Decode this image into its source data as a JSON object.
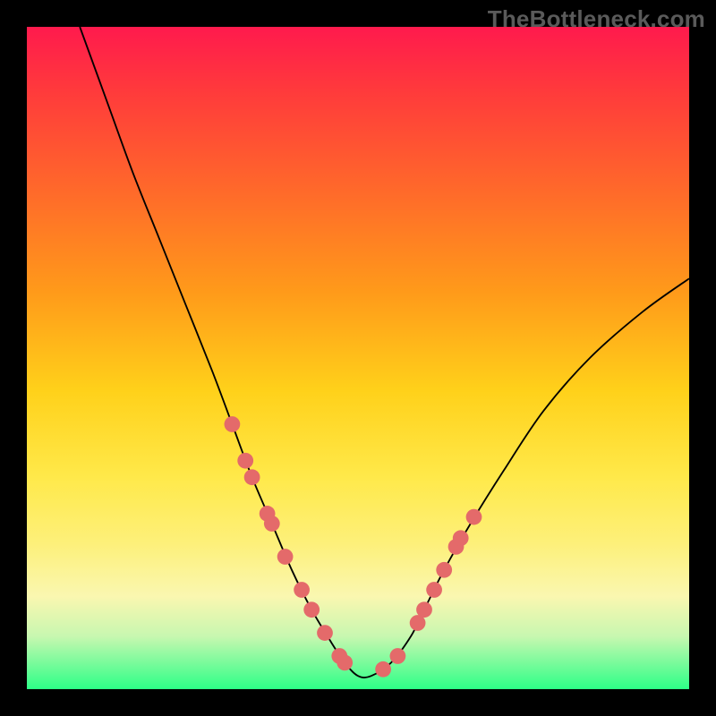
{
  "watermark": "TheBottleneck.com",
  "chart_data": {
    "type": "line",
    "title": "",
    "xlabel": "",
    "ylabel": "",
    "xlim": [
      0,
      100
    ],
    "ylim": [
      0,
      100
    ],
    "grid": false,
    "legend": false,
    "series": [
      {
        "name": "bottleneck-curve",
        "x": [
          8,
          12,
          16,
          20,
          24,
          28,
          31,
          34,
          37,
          40,
          43,
          46,
          48,
          50,
          52,
          55,
          58,
          60,
          63,
          67,
          72,
          78,
          85,
          93,
          100
        ],
        "y": [
          100,
          89,
          78,
          68,
          58,
          48,
          40,
          32,
          25,
          18,
          12,
          7,
          4,
          2,
          2,
          4,
          8,
          12,
          18,
          25,
          33,
          42,
          50,
          57,
          62
        ],
        "color": "#000000"
      }
    ],
    "markers": {
      "name": "highlight-dots",
      "color": "#e46a6a",
      "radius_pct": 1.2,
      "points": [
        {
          "x": 31.0,
          "y": 40.0
        },
        {
          "x": 33.0,
          "y": 34.5
        },
        {
          "x": 34.0,
          "y": 32.0
        },
        {
          "x": 36.3,
          "y": 26.5
        },
        {
          "x": 37.0,
          "y": 25.0
        },
        {
          "x": 39.0,
          "y": 20.0
        },
        {
          "x": 41.5,
          "y": 15.0
        },
        {
          "x": 43.0,
          "y": 12.0
        },
        {
          "x": 45.0,
          "y": 8.5
        },
        {
          "x": 47.2,
          "y": 5.0
        },
        {
          "x": 48.0,
          "y": 4.0
        },
        {
          "x": 53.8,
          "y": 3.0
        },
        {
          "x": 56.0,
          "y": 5.0
        },
        {
          "x": 59.0,
          "y": 10.0
        },
        {
          "x": 60.0,
          "y": 12.0
        },
        {
          "x": 61.5,
          "y": 15.0
        },
        {
          "x": 63.0,
          "y": 18.0
        },
        {
          "x": 64.8,
          "y": 21.5
        },
        {
          "x": 65.5,
          "y": 22.8
        },
        {
          "x": 67.5,
          "y": 26.0
        }
      ]
    }
  }
}
